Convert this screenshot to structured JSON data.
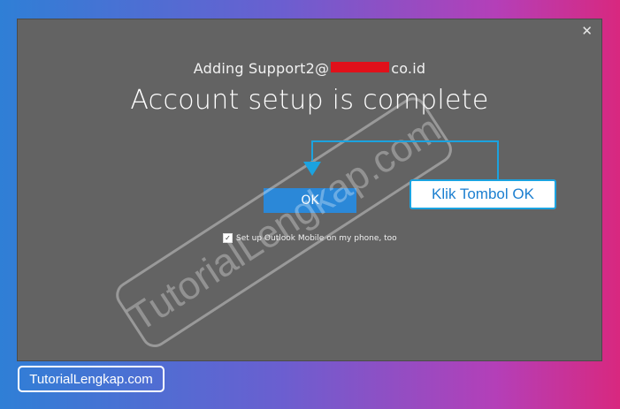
{
  "dialog": {
    "adding_prefix": "Adding Support2@",
    "adding_suffix": "co.id",
    "title": "Account setup is complete",
    "ok_label": "OK",
    "checkbox_label": "Set up Outlook Mobile on my phone, too",
    "checkbox_checked": true,
    "close_glyph": "✕"
  },
  "annotation": {
    "callout_label": "Klik Tombol OK",
    "accent_color": "#1ba3e0"
  },
  "watermark": {
    "text": "TutorialLengkap.com"
  },
  "branding": {
    "label": "TutorialLengkap.com"
  }
}
